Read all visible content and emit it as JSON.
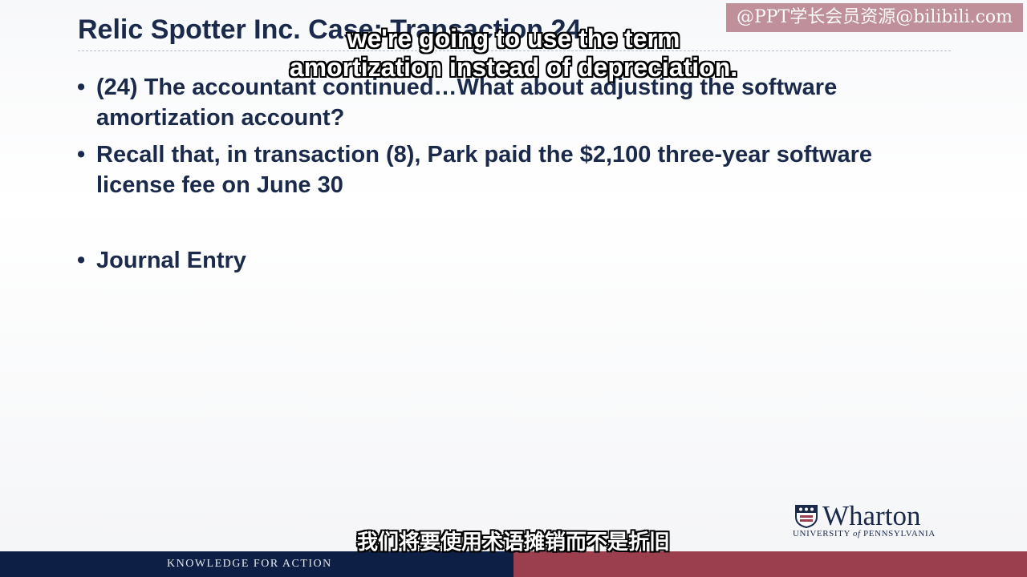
{
  "slide": {
    "title": "Relic Spotter Inc. Case: Transaction 24",
    "bullets": [
      {
        "marker": "•",
        "text": "(24) The accountant continued…What about adjusting the software amortization account?"
      },
      {
        "marker": "•",
        "text": "Recall that, in transaction (8), Park paid the $2,100 three-year software license fee on June 30"
      },
      {
        "marker": "•",
        "text": "Journal Entry"
      }
    ]
  },
  "subtitles": {
    "english_line1": "we're going to use the term",
    "english_line2": "amortization instead of depreciation.",
    "chinese": "我们将要使用术语摊销而不是折旧"
  },
  "watermark": {
    "text": "@PPT学长会员资源@bilibili.com"
  },
  "logo": {
    "name": "Wharton",
    "subtitle_pre": "UNIVERSITY ",
    "subtitle_of": "of",
    "subtitle_post": " PENNSYLVANIA"
  },
  "footer": {
    "tagline": "KNOWLEDGE FOR ACTION"
  },
  "colors": {
    "navy": "#0d1f44",
    "maroon": "#9b3e4e",
    "text": "#1b2a4a"
  }
}
